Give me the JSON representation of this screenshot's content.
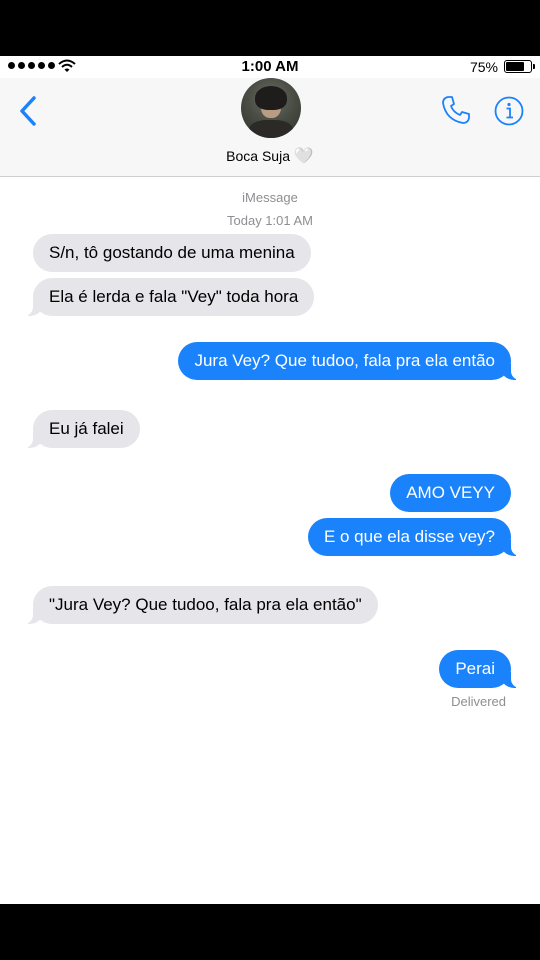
{
  "status_bar": {
    "time": "1:00 AM",
    "battery": "75%",
    "battery_level": 0.75
  },
  "header": {
    "contact_name": "Boca Suja",
    "heart": "🤍"
  },
  "thread": {
    "service": "iMessage",
    "timestamp": "Today 1:01 AM"
  },
  "messages": [
    {
      "dir": "in",
      "text": "S/n, tô gostando de uma menina"
    },
    {
      "dir": "in",
      "text": "Ela é lerda e fala \"Vey\" toda hora"
    },
    {
      "dir": "out",
      "text": "Jura Vey? Que tudoo, fala pra ela então"
    },
    {
      "dir": "in",
      "text": "Eu já falei"
    },
    {
      "dir": "out",
      "text": "AMO VEYY"
    },
    {
      "dir": "out",
      "text": "E o que ela disse vey?"
    },
    {
      "dir": "in",
      "text": "\"Jura Vey? Que tudoo, fala pra ela então\""
    },
    {
      "dir": "out",
      "text": "Perai"
    }
  ],
  "delivery_status": "Delivered",
  "colors": {
    "accent": "#1a82fb",
    "incoming": "#e5e5ea"
  }
}
